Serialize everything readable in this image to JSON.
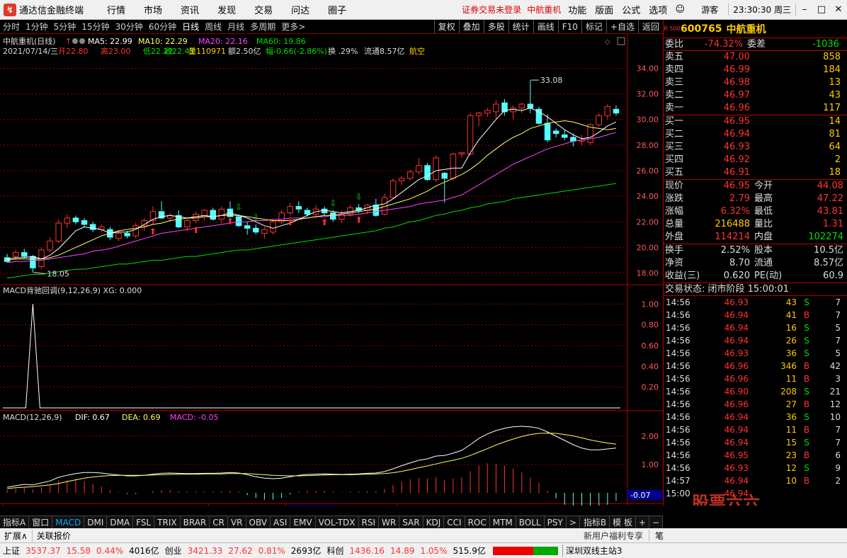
{
  "app": {
    "title": "通达信金融终端",
    "menus": [
      "行情",
      "市场",
      "资讯",
      "发现",
      "交易",
      "问达",
      "圈子"
    ],
    "notice": "证券交易未登录",
    "stock_name_link": "中航重机",
    "menus2": [
      "功能",
      "版面",
      "公式",
      "选项"
    ],
    "guest": "游客",
    "clock": "23:30:30 周三"
  },
  "toolbar": {
    "periods": [
      "分时",
      "1分钟",
      "5分钟",
      "15分钟",
      "30分钟",
      "60分钟",
      "日线",
      "周线",
      "月线",
      "多周期",
      "更多"
    ],
    "active_period": "日线",
    "more_arrow": ">",
    "buttons": [
      "复权",
      "叠加",
      "多股",
      "统计",
      "画线",
      "F10",
      "标记",
      "+自选",
      "返回"
    ]
  },
  "kline": {
    "title": "中航重机(日线)",
    "ma": [
      {
        "label": "MA5: 22.99",
        "color": "#ffffff"
      },
      {
        "label": "MA10: 22.29",
        "color": "#ffff66"
      },
      {
        "label": "MA20: 22.16",
        "color": "#ff44ff"
      },
      {
        "label": "MA60: 19.86",
        "color": "#00dd00"
      }
    ],
    "info": {
      "date": "2021/07/14/三",
      "open": "开22.80",
      "high": "高23.00",
      "low": "低22.22",
      "close": "收22.43",
      "vol": "量110971",
      "amt": "额2.50亿",
      "change": "幅-0.66(-2.86%)",
      "turn": "换 .29%",
      "float": "流通8.57亿",
      "sector": "航空"
    },
    "y_ticks": [
      "34.00",
      "32.00",
      "30.00",
      "28.00",
      "26.00",
      "24.00",
      "22.00",
      "20.00",
      "18.00"
    ],
    "y_range": [
      17.2,
      34.8
    ],
    "max_label": "33.08",
    "min_label": "18.05"
  },
  "chart_data": {
    "type": "candlestick",
    "candles": [
      [
        19.2,
        19.5,
        18.8,
        18.9
      ],
      [
        19.3,
        19.8,
        19.0,
        19.6
      ],
      [
        19.6,
        19.9,
        19.2,
        19.3
      ],
      [
        19.3,
        19.4,
        18.05,
        18.4
      ],
      [
        18.5,
        20.0,
        18.3,
        19.8
      ],
      [
        19.8,
        20.8,
        19.6,
        20.5
      ],
      [
        20.5,
        22.2,
        20.3,
        21.9
      ],
      [
        21.9,
        22.6,
        21.5,
        22.3
      ],
      [
        22.3,
        22.5,
        21.8,
        22.0
      ],
      [
        22.1,
        22.3,
        21.6,
        21.8
      ],
      [
        21.8,
        22.0,
        21.2,
        21.4
      ],
      [
        21.4,
        21.8,
        21.2,
        21.6
      ],
      [
        21.4,
        21.6,
        20.6,
        20.8
      ],
      [
        20.7,
        21.3,
        20.5,
        21.1
      ],
      [
        21.1,
        21.3,
        20.7,
        20.9
      ],
      [
        20.9,
        21.9,
        20.7,
        21.7
      ],
      [
        21.7,
        22.3,
        21.3,
        22.1
      ],
      [
        22.1,
        23.2,
        21.8,
        22.8
      ],
      [
        22.8,
        23.6,
        22.2,
        22.3
      ],
      [
        22.3,
        22.7,
        22.0,
        22.5
      ],
      [
        22.5,
        22.9,
        21.5,
        21.6
      ],
      [
        21.6,
        22.3,
        21.3,
        22.1
      ],
      [
        22.1,
        22.8,
        21.9,
        22.6
      ],
      [
        22.4,
        23.0,
        22.1,
        22.9
      ],
      [
        22.9,
        23.1,
        22.1,
        22.2
      ],
      [
        22.2,
        23.2,
        21.9,
        23.0
      ],
      [
        23.0,
        23.6,
        22.6,
        22.4
      ],
      [
        22.4,
        22.6,
        21.6,
        21.7
      ],
      [
        21.7,
        22.0,
        21.0,
        21.5
      ],
      [
        21.5,
        21.8,
        21.0,
        21.2
      ],
      [
        21.1,
        21.6,
        20.7,
        21.4
      ],
      [
        21.2,
        22.2,
        21.0,
        22.0
      ],
      [
        22.0,
        22.9,
        21.8,
        22.7
      ],
      [
        22.7,
        23.5,
        22.5,
        23.2
      ],
      [
        23.2,
        23.6,
        22.7,
        23.0
      ],
      [
        22.9,
        23.1,
        22.4,
        22.6
      ],
      [
        22.6,
        23.3,
        22.3,
        23.0
      ],
      [
        23.0,
        23.2,
        22.5,
        22.7
      ],
      [
        22.7,
        22.9,
        22.0,
        22.2
      ],
      [
        22.2,
        22.9,
        21.9,
        22.6
      ],
      [
        22.6,
        23.3,
        22.4,
        23.1
      ],
      [
        23.1,
        23.4,
        22.7,
        22.9
      ],
      [
        22.9,
        23.4,
        22.6,
        23.3
      ],
      [
        23.3,
        23.8,
        22.4,
        22.5
      ],
      [
        22.6,
        24.2,
        22.5,
        23.9
      ],
      [
        23.9,
        25.4,
        23.8,
        25.2
      ],
      [
        25.2,
        25.6,
        24.9,
        25.4
      ],
      [
        25.4,
        26.1,
        25.2,
        25.9
      ],
      [
        25.9,
        27.0,
        25.7,
        26.4
      ],
      [
        26.4,
        26.6,
        25.2,
        25.3
      ],
      [
        25.3,
        27.2,
        25.1,
        27.0
      ],
      [
        25.8,
        25.9,
        23.5,
        25.4
      ],
      [
        25.4,
        27.4,
        25.2,
        27.3
      ],
      [
        27.3,
        27.5,
        27.0,
        27.4
      ],
      [
        27.3,
        30.5,
        27.2,
        30.3
      ],
      [
        30.3,
        30.6,
        29.5,
        30.5
      ],
      [
        30.5,
        30.9,
        30.2,
        30.7
      ],
      [
        30.6,
        31.5,
        30.0,
        31.2
      ],
      [
        31.3,
        31.6,
        30.3,
        30.6
      ],
      [
        30.6,
        31.1,
        30.0,
        30.9
      ],
      [
        30.9,
        31.3,
        30.5,
        31.2
      ],
      [
        31.2,
        33.08,
        30.5,
        30.9
      ],
      [
        30.8,
        31.0,
        29.6,
        29.7
      ],
      [
        29.7,
        30.4,
        28.2,
        28.4
      ],
      [
        29.1,
        29.3,
        28.6,
        28.9
      ],
      [
        28.8,
        29.2,
        28.4,
        28.6
      ],
      [
        28.6,
        28.9,
        27.9,
        28.3
      ],
      [
        28.3,
        28.8,
        28.0,
        28.4
      ],
      [
        28.2,
        29.7,
        28.0,
        29.6
      ],
      [
        29.6,
        30.5,
        29.4,
        30.3
      ],
      [
        30.3,
        31.2,
        30.0,
        31.0
      ],
      [
        30.8,
        31.1,
        30.3,
        30.5
      ]
    ],
    "ma5": [
      19.1,
      19.2,
      19.2,
      19.3,
      19.1,
      19.4,
      19.9,
      20.6,
      21.3,
      21.6,
      21.5,
      21.4,
      21.1,
      21.2,
      21.2,
      21.4,
      21.8,
      22.2,
      22.4,
      22.5,
      22.4,
      22.3,
      22.4,
      22.5,
      22.4,
      22.5,
      22.7,
      22.5,
      22.3,
      22.0,
      21.7,
      21.5,
      21.7,
      21.9,
      22.2,
      22.5,
      22.8,
      22.9,
      22.8,
      22.7,
      22.8,
      22.9,
      23.1,
      23.3,
      23.4,
      23.8,
      24.3,
      24.8,
      25.3,
      25.6,
      26.0,
      26.1,
      26.2,
      26.2,
      27.4,
      28.4,
      29.2,
      30.0,
      30.7,
      30.8,
      30.7,
      30.9,
      30.6,
      30.2,
      29.7,
      29.2,
      28.8,
      28.5,
      28.6,
      29.0,
      29.5,
      29.8
    ],
    "ma10": [
      19.0,
      19.1,
      19.1,
      19.1,
      19.1,
      19.2,
      19.4,
      19.7,
      20.0,
      20.3,
      20.6,
      20.9,
      21.1,
      21.3,
      21.4,
      21.5,
      21.6,
      21.8,
      21.9,
      22.1,
      22.2,
      22.3,
      22.3,
      22.4,
      22.4,
      22.5,
      22.5,
      22.5,
      22.4,
      22.3,
      22.2,
      22.1,
      22.1,
      22.1,
      22.2,
      22.3,
      22.4,
      22.5,
      22.5,
      22.6,
      22.7,
      22.8,
      22.9,
      23.0,
      23.2,
      23.4,
      23.6,
      23.8,
      24.1,
      24.4,
      24.8,
      25.1,
      25.4,
      25.7,
      26.1,
      26.6,
      27.2,
      27.7,
      28.2,
      28.6,
      28.9,
      29.3,
      29.5,
      29.7,
      29.8,
      29.9,
      29.8,
      29.6,
      29.4,
      29.3,
      29.2,
      29.3
    ],
    "ma20": [
      18.8,
      18.9,
      18.9,
      19.0,
      19.0,
      19.1,
      19.2,
      19.3,
      19.4,
      19.5,
      19.7,
      19.8,
      19.9,
      20.1,
      20.3,
      20.5,
      20.7,
      20.9,
      21.1,
      21.2,
      21.3,
      21.4,
      21.5,
      21.6,
      21.7,
      21.8,
      21.9,
      22.0,
      22.0,
      22.1,
      22.1,
      22.2,
      22.2,
      22.3,
      22.3,
      22.3,
      22.4,
      22.4,
      22.5,
      22.5,
      22.5,
      22.6,
      22.7,
      22.8,
      22.9,
      23.0,
      23.1,
      23.2,
      23.4,
      23.5,
      23.6,
      23.7,
      23.9,
      24.1,
      24.5,
      24.9,
      25.3,
      25.7,
      26.1,
      26.5,
      26.8,
      27.1,
      27.4,
      27.7,
      27.9,
      28.1,
      28.3,
      28.4,
      28.5,
      28.6,
      28.8,
      29.0
    ],
    "ma60": [
      17.6,
      17.7,
      17.8,
      17.9,
      17.9,
      18.0,
      18.1,
      18.2,
      18.3,
      18.3,
      18.4,
      18.5,
      18.6,
      18.7,
      18.7,
      18.8,
      18.9,
      19.0,
      19.0,
      19.1,
      19.2,
      19.3,
      19.3,
      19.4,
      19.5,
      19.6,
      19.7,
      19.8,
      19.8,
      19.9,
      20.0,
      20.1,
      20.2,
      20.3,
      20.4,
      20.5,
      20.6,
      20.7,
      20.8,
      20.9,
      21.0,
      21.1,
      21.2,
      21.3,
      21.5,
      21.6,
      21.8,
      22.0,
      22.1,
      22.3,
      22.5,
      22.6,
      22.8,
      22.9,
      23.1,
      23.2,
      23.4,
      23.5,
      23.6,
      23.8,
      23.9,
      24.0,
      24.1,
      24.2,
      24.3,
      24.4,
      24.5,
      24.6,
      24.7,
      24.8,
      24.9,
      25.0
    ],
    "macd_dif": [
      0.2,
      0.25,
      0.3,
      0.28,
      0.35,
      0.42,
      0.55,
      0.62,
      0.68,
      0.72,
      0.72,
      0.7,
      0.66,
      0.63,
      0.6,
      0.6,
      0.62,
      0.66,
      0.69,
      0.7,
      0.69,
      0.68,
      0.68,
      0.69,
      0.69,
      0.7,
      0.72,
      0.7,
      0.64,
      0.57,
      0.52,
      0.5,
      0.52,
      0.57,
      0.62,
      0.65,
      0.66,
      0.67,
      0.66,
      0.65,
      0.66,
      0.67,
      0.69,
      0.7,
      0.75,
      0.85,
      0.96,
      1.06,
      1.15,
      1.2,
      1.3,
      1.32,
      1.4,
      1.5,
      1.7,
      1.92,
      2.08,
      2.2,
      2.28,
      2.33,
      2.35,
      2.33,
      2.28,
      2.15,
      2.0,
      1.85,
      1.7,
      1.58,
      1.52,
      1.52,
      1.55,
      1.58
    ],
    "macd_dea": [
      0.15,
      0.18,
      0.2,
      0.22,
      0.25,
      0.28,
      0.33,
      0.4,
      0.46,
      0.52,
      0.56,
      0.59,
      0.61,
      0.62,
      0.62,
      0.62,
      0.62,
      0.63,
      0.64,
      0.65,
      0.66,
      0.66,
      0.66,
      0.67,
      0.67,
      0.67,
      0.68,
      0.68,
      0.68,
      0.66,
      0.64,
      0.62,
      0.61,
      0.6,
      0.6,
      0.61,
      0.62,
      0.63,
      0.64,
      0.64,
      0.64,
      0.65,
      0.66,
      0.67,
      0.68,
      0.71,
      0.76,
      0.82,
      0.89,
      0.95,
      1.02,
      1.09,
      1.15,
      1.22,
      1.32,
      1.44,
      1.56,
      1.69,
      1.8,
      1.9,
      1.99,
      2.06,
      2.1,
      2.11,
      2.1,
      2.06,
      2.01,
      1.94,
      1.87,
      1.81,
      1.76,
      1.72
    ],
    "xg_signal_index": 3,
    "buy_arrows": [
      27,
      29,
      38,
      41
    ],
    "sell_arrows": [
      17,
      22,
      26,
      33,
      37,
      41
    ]
  },
  "panel2": {
    "title": "MACD背驰回调(9,12,26,9) XG: 0.000",
    "y_ticks": [
      "1.00",
      "0.80",
      "0.60",
      "0.40",
      "0.20"
    ]
  },
  "panel3": {
    "title_main": "MACD(12,26,9)",
    "dif": "DIF: 0.67",
    "dea": "DEA: 0.69",
    "macd": "MACD: -0.05",
    "y_ticks": [
      "2.00",
      "1.00"
    ],
    "cur_label": "-0.07"
  },
  "xaxis": {
    "labels": [
      {
        "text": "2021年",
        "i": 0
      },
      {
        "text": "7",
        "i": 24
      },
      {
        "text": "2021/07/14/三",
        "i": 33,
        "hl": true
      },
      {
        "text": "8",
        "i": 46
      }
    ],
    "period": "日线"
  },
  "tabs": {
    "left": [
      "指标A",
      "窗口"
    ],
    "items": [
      "MACD",
      "DMI",
      "DMA",
      "FSL",
      "TRIX",
      "BRAR",
      "CR",
      "VR",
      "OBV",
      "ASI",
      "EMV",
      "VOL-TDX",
      "RSI",
      "WR",
      "SAR",
      "KDJ",
      "CCI",
      "ROC",
      "MTM",
      "BOLL",
      "PSY"
    ],
    "active": "MACD",
    "more": ">",
    "right": [
      "指标B",
      "模 板",
      "+",
      "−"
    ]
  },
  "ext": {
    "left": [
      "扩展∧",
      "关联报价"
    ],
    "news": "新用户福利专享",
    "btn": "笔"
  },
  "quote": {
    "badge": "R 500",
    "code": "600765",
    "name": "中航重机",
    "weibi_label": "委比",
    "weibi": "-74.32%",
    "weicha_label": "委差",
    "weicha": "-1036",
    "asks": [
      {
        "label": "卖五",
        "price": "47.00",
        "vol": "858"
      },
      {
        "label": "卖四",
        "price": "46.99",
        "vol": "184"
      },
      {
        "label": "卖三",
        "price": "46.98",
        "vol": "13"
      },
      {
        "label": "卖二",
        "price": "46.97",
        "vol": "43"
      },
      {
        "label": "卖一",
        "price": "46.96",
        "vol": "117"
      }
    ],
    "bids": [
      {
        "label": "买一",
        "price": "46.95",
        "vol": "14"
      },
      {
        "label": "买二",
        "price": "46.94",
        "vol": "81"
      },
      {
        "label": "买三",
        "price": "46.93",
        "vol": "64"
      },
      {
        "label": "买四",
        "price": "46.92",
        "vol": "2"
      },
      {
        "label": "买五",
        "price": "46.91",
        "vol": "18"
      }
    ],
    "stats": [
      [
        {
          "l": "现价",
          "v": "46.95",
          "c": "red"
        },
        {
          "l": "今开",
          "v": "44.08",
          "c": "red"
        }
      ],
      [
        {
          "l": "涨跌",
          "v": "2.79",
          "c": "red"
        },
        {
          "l": "最高",
          "v": "47.22",
          "c": "red"
        }
      ],
      [
        {
          "l": "涨幅",
          "v": "6.32%",
          "c": "red"
        },
        {
          "l": "最低",
          "v": "43.81",
          "c": "red"
        }
      ],
      [
        {
          "l": "总量",
          "v": "216488",
          "c": "yel"
        },
        {
          "l": "量比",
          "v": "1.31",
          "c": "red"
        }
      ],
      [
        {
          "l": "外盘",
          "v": "114214",
          "c": "red"
        },
        {
          "l": "内盘",
          "v": "102274",
          "c": "grn"
        }
      ]
    ],
    "fin": [
      [
        {
          "l": "换手",
          "v": "2.52%"
        },
        {
          "l": "股本",
          "v": "10.5亿"
        }
      ],
      [
        {
          "l": "净资",
          "v": "8.70"
        },
        {
          "l": "流通",
          "v": "8.57亿"
        }
      ],
      [
        {
          "l": "收益(三)",
          "v": "0.620"
        },
        {
          "l": "PE(动)",
          "v": "60.9"
        }
      ]
    ],
    "trade_status": "交易状态: 闭市阶段 15:00:01",
    "ticks": [
      [
        "14:56",
        "46.93",
        "43",
        "S",
        "7"
      ],
      [
        "14:56",
        "46.94",
        "41",
        "B",
        "7"
      ],
      [
        "14:56",
        "46.94",
        "16",
        "S",
        "5"
      ],
      [
        "14:56",
        "46.94",
        "26",
        "S",
        "7"
      ],
      [
        "14:56",
        "46.93",
        "36",
        "S",
        "5"
      ],
      [
        "14:56",
        "46.96",
        "346",
        "B",
        "42"
      ],
      [
        "14:56",
        "46.96",
        "11",
        "B",
        "3"
      ],
      [
        "14:56",
        "46.90",
        "208",
        "S",
        "21"
      ],
      [
        "14:56",
        "46.96",
        "27",
        "B",
        "12"
      ],
      [
        "14:56",
        "46.94",
        "36",
        "S",
        "10"
      ],
      [
        "14:56",
        "46.94",
        "11",
        "B",
        "7"
      ],
      [
        "14:56",
        "46.94",
        "15",
        "S",
        "7"
      ],
      [
        "14:56",
        "46.95",
        "23",
        "B",
        "6"
      ],
      [
        "14:56",
        "46.93",
        "12",
        "S",
        "9"
      ],
      [
        "14:57",
        "46.94",
        "10",
        "B",
        "2"
      ],
      [
        "15:00",
        "46.94",
        "",
        "",
        ""
      ]
    ],
    "watermark": "股票六六"
  },
  "status": {
    "sh_label": "上证",
    "sh_idx": "3537.37",
    "sh_chg": "15.58",
    "sh_pct": "0.44%",
    "sh_amt": "4016亿",
    "cy_label": "创业",
    "cy_idx": "3421.33",
    "cy_chg": "27.62",
    "cy_pct": "0.81%",
    "cy_amt": "2693亿",
    "kc_label": "科创",
    "kc_idx": "1436.16",
    "kc_chg": "14.89",
    "kc_pct": "1.05%",
    "kc_amt": "515.9亿",
    "server": "深圳双线主站3"
  },
  "colors": {
    "up": "#ff3232",
    "down": "#54ffff",
    "ma5": "#ffffff",
    "ma10": "#ffff66",
    "ma20": "#ff44ff",
    "ma60": "#00dd00",
    "grid": "#8b0000"
  }
}
